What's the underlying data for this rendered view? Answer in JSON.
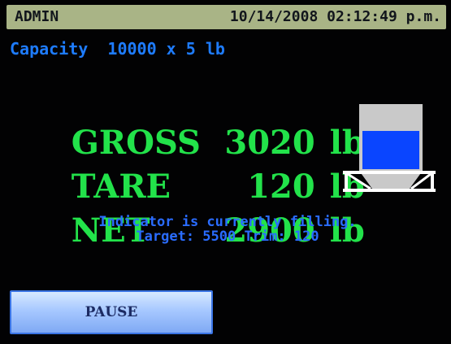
{
  "header": {
    "user": "ADMIN",
    "datetime": "10/14/2008 02:12:49 p.m."
  },
  "capacity": {
    "text": "Capacity  10000 x 5 lb"
  },
  "readings": {
    "gross": {
      "label": "GROSS",
      "value": "3020",
      "unit": "lb"
    },
    "tare": {
      "label": "TARE",
      "value": "120",
      "unit": "lb"
    },
    "net": {
      "label": "NET",
      "value": "2900",
      "unit": "lb"
    }
  },
  "status": {
    "line1": "Indicator is currently filling.",
    "line2": "Target: 5500 Trim: 120"
  },
  "hopper": {
    "icon": "hopper-icon",
    "fill_level": 0.62,
    "colors": {
      "frame": "#c9c9c9",
      "fill": "#0a45ff",
      "stand": "#ffffff"
    }
  },
  "buttons": {
    "pause_label": "PAUSE"
  },
  "colors": {
    "background": "#020203",
    "header_bar": "#a9b486",
    "reading": "#22e24a",
    "info": "#1e7cff"
  }
}
